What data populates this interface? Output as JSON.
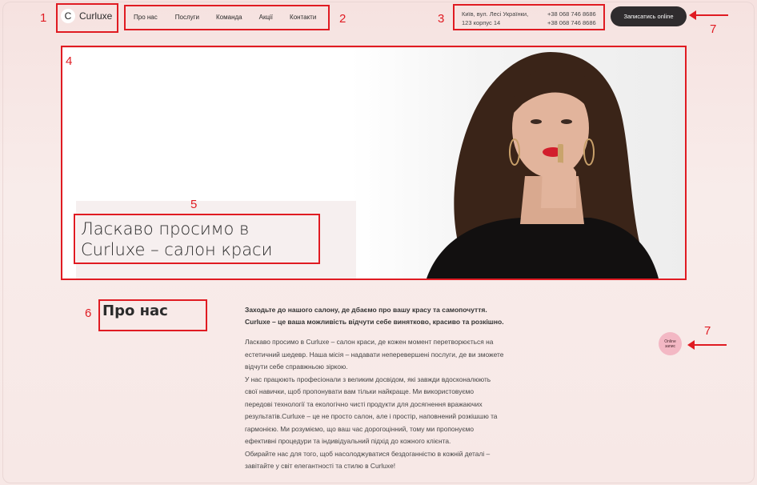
{
  "logo": {
    "mark": "C",
    "text": "Curluxe"
  },
  "nav": {
    "items": [
      {
        "label": "Про нас"
      },
      {
        "label": "Послуги"
      },
      {
        "label": "Команда"
      },
      {
        "label": "Акції"
      },
      {
        "label": "Контакти"
      }
    ]
  },
  "contacts": {
    "address_line1": "Київ, вул. Лесі Українки,",
    "address_line2": "123 корпус 14",
    "phone1": "+38 068 746 8686",
    "phone2": "+38 068 746 8686"
  },
  "header": {
    "cta_label": "Записатись online"
  },
  "hero": {
    "title_line1": "Ласкаво просимо в",
    "title_line2": "Curluxe – салон краси"
  },
  "about": {
    "title": "Про нас",
    "lead_line1": "Заходьте до нашого салону, де дбаємо про вашу красу та самопочуття.",
    "lead_line2": "Curluxe – це ваша можливість відчути себе винятково, красиво та розкішно.",
    "body_lines": [
      "Ласкаво просимо в Curluxe – салон краси, де кожен момент перетворюється на",
      "естетичний шедевр. Наша місія – надавати неперевершені послуги, де ви зможете",
      "відчути себе справжньою зіркою.",
      "У нас працюють професіонали з великим досвідом, які завжди вдосконалюють",
      "свої навички, щоб пропонувати вам тільки найкраще. Ми використовуємо",
      "передові технології та екологічно чисті продукти для досягнення вражаючих",
      "результатів.Curluxe – це не просто салон, але і простір, наповнений розкішшю та",
      "гармонією. Ми розуміємо, що ваш час дорогоцінний, тому ми пропонуємо",
      "ефективні процедури та індивідуальний підхід до кожного клієнта.",
      "Обирайте нас для того, щоб насолоджуватися бездоганністю в кожній деталі –",
      "завітайте у світ елегантності та стилю в Curluxe!"
    ]
  },
  "online_button": {
    "line1": "Online",
    "line2": "запис"
  },
  "annotations": [
    "1",
    "2",
    "3",
    "4",
    "5",
    "6",
    "7",
    "7"
  ],
  "colors": {
    "accent": "#e01b22",
    "cta_bg": "#2f2c2e",
    "online_bg": "#f3b8c4"
  }
}
